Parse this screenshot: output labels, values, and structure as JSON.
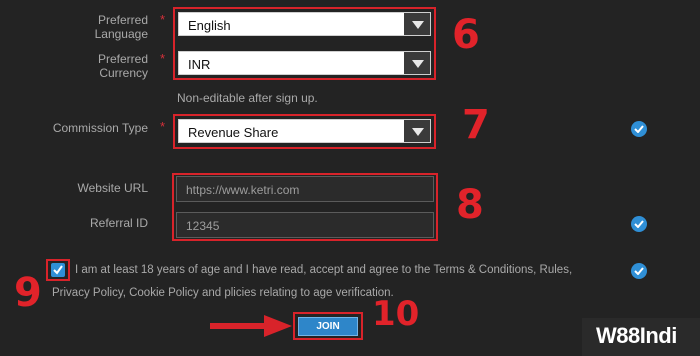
{
  "form": {
    "preferred_language": {
      "label": "Preferred Language",
      "required": "*",
      "value": "English"
    },
    "preferred_currency": {
      "label": "Preferred Currency",
      "required": "*",
      "value": "INR"
    },
    "non_editable_note": "Non-editable after sign up.",
    "commission_type": {
      "label": "Commission Type",
      "required": "*",
      "value": "Revenue Share"
    },
    "website_url": {
      "label": "Website URL",
      "value": "https://www.ketri.com"
    },
    "referral_id": {
      "label": "Referral ID",
      "value": "12345"
    },
    "terms": {
      "line1": "I am at least 18 years of age and I have read, accept and agree to the Terms & Conditions, Rules,",
      "line2": "Privacy Policy, Cookie Policy and plicies relating to age verification.",
      "checked": true
    },
    "join_label": "JOIN"
  },
  "annotations": {
    "n6": "6",
    "n7": "7",
    "n8": "8",
    "n9": "9",
    "n10": "10"
  },
  "brand": {
    "logo": "W88Indi"
  },
  "colors": {
    "accent": "#2f8fd6",
    "annotation": "#d8232a",
    "background": "#232323"
  }
}
